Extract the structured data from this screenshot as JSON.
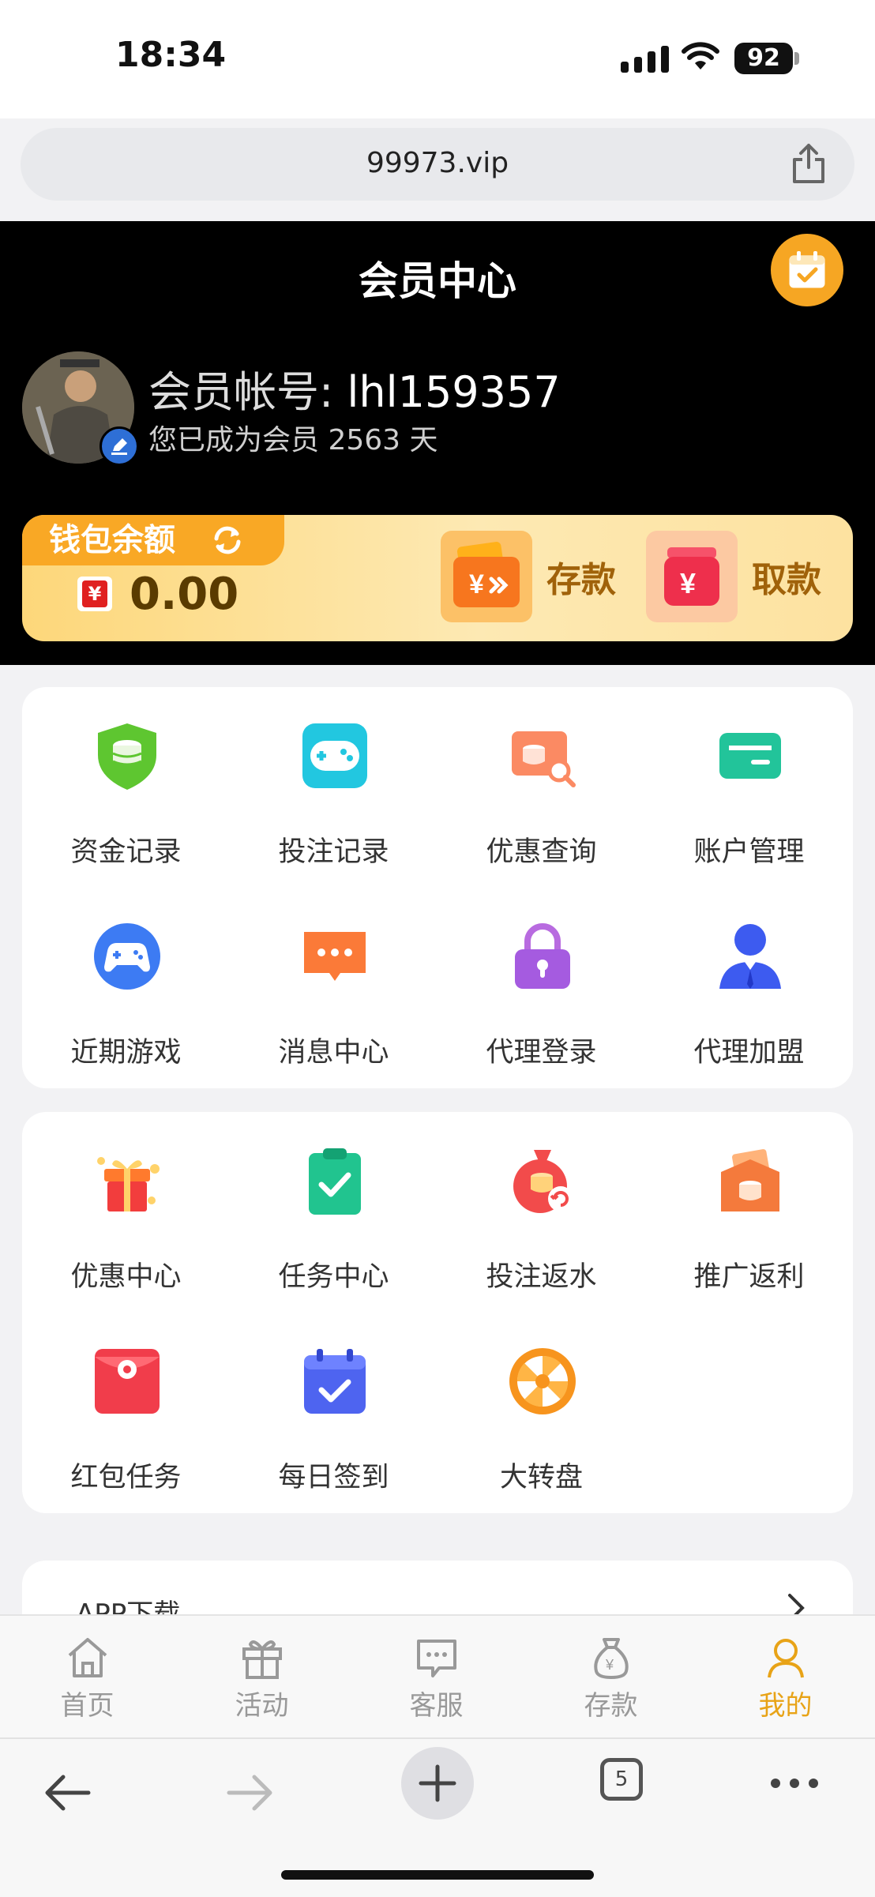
{
  "status_bar": {
    "time": "18:34",
    "battery": "92"
  },
  "browser": {
    "url": "99973.vip",
    "tabs_count": "5"
  },
  "header": {
    "title": "会员中心",
    "account_label": "会员帐号: ",
    "account_id": "lhl159357",
    "member_days_text": "您已成为会员 2563 天"
  },
  "wallet": {
    "label": "钱包余额",
    "currency_symbol": "¥",
    "balance": "0.00",
    "deposit_label": "存款",
    "withdraw_label": "取款"
  },
  "grid1": {
    "items": [
      {
        "label": "资金记录",
        "icon": "shield-coins-icon"
      },
      {
        "label": "投注记录",
        "icon": "gamepad-icon"
      },
      {
        "label": "优惠查询",
        "icon": "coupon-search-icon"
      },
      {
        "label": "账户管理",
        "icon": "card-icon"
      },
      {
        "label": "近期游戏",
        "icon": "game-controller-icon"
      },
      {
        "label": "消息中心",
        "icon": "message-icon"
      },
      {
        "label": "代理登录",
        "icon": "lock-icon"
      },
      {
        "label": "代理加盟",
        "icon": "agent-person-icon"
      }
    ]
  },
  "grid2": {
    "items": [
      {
        "label": "优惠中心",
        "icon": "gift-box-icon"
      },
      {
        "label": "任务中心",
        "icon": "clipboard-check-icon"
      },
      {
        "label": "投注返水",
        "icon": "money-bag-rebate-icon"
      },
      {
        "label": "推广返利",
        "icon": "envelope-coins-icon"
      },
      {
        "label": "红包任务",
        "icon": "red-envelope-icon"
      },
      {
        "label": "每日签到",
        "icon": "calendar-check-icon"
      },
      {
        "label": "大转盘",
        "icon": "wheel-icon"
      }
    ]
  },
  "app_download": {
    "label": "APP下载"
  },
  "bottom_nav": {
    "items": [
      {
        "label": "首页",
        "icon": "home-icon"
      },
      {
        "label": "活动",
        "icon": "gift-icon"
      },
      {
        "label": "客服",
        "icon": "chat-icon"
      },
      {
        "label": "存款",
        "icon": "money-bag-icon"
      },
      {
        "label": "我的",
        "icon": "person-icon"
      }
    ],
    "active_index": 4,
    "active_color": "#e8a317"
  },
  "colors": {
    "header_bg": "#000000",
    "wallet_accent": "#f9a825",
    "brand": "#e8a317"
  }
}
